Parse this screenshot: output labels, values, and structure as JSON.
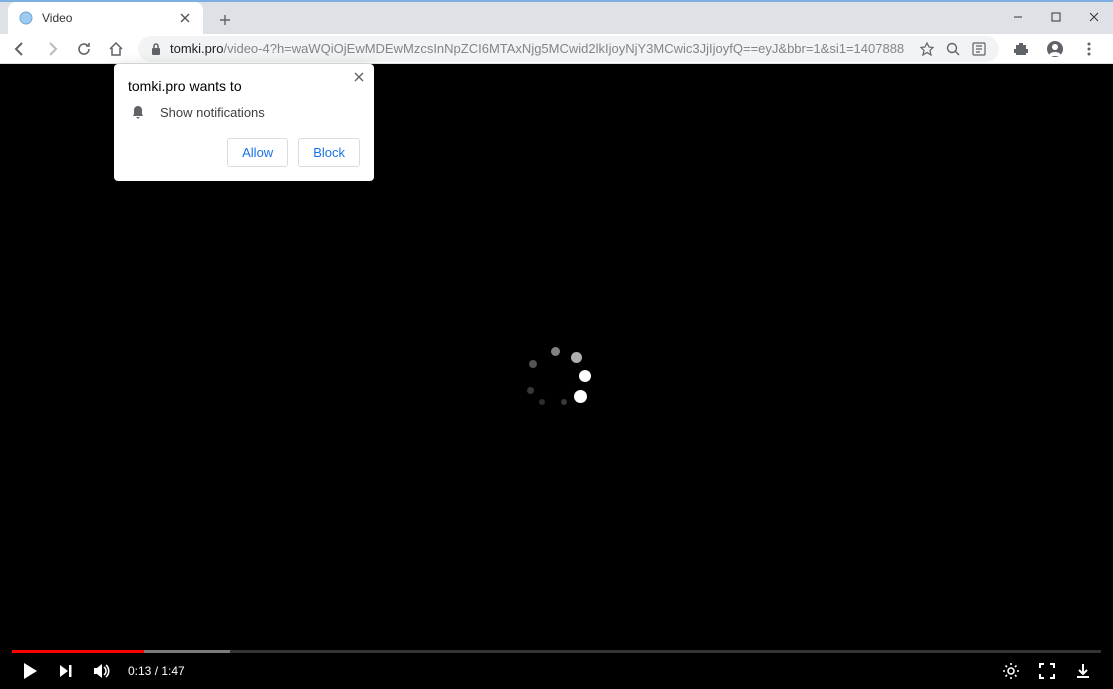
{
  "tab": {
    "title": "Video"
  },
  "url": {
    "domain": "tomki.pro",
    "path": "/video-4?h=waWQiOjEwMDEwMzcsInNpZCI6MTAxNjg5MCwid2lkIjoyNjY3MCwic3JjIjoyfQ==eyJ&bbr=1&si1=1407888"
  },
  "permission": {
    "title": "tomki.pro wants to",
    "item": "Show notifications",
    "allow": "Allow",
    "block": "Block"
  },
  "video": {
    "current_time": "0:13",
    "duration": "1:47",
    "progress_percent": 12.1,
    "buffered_percent": 20
  }
}
